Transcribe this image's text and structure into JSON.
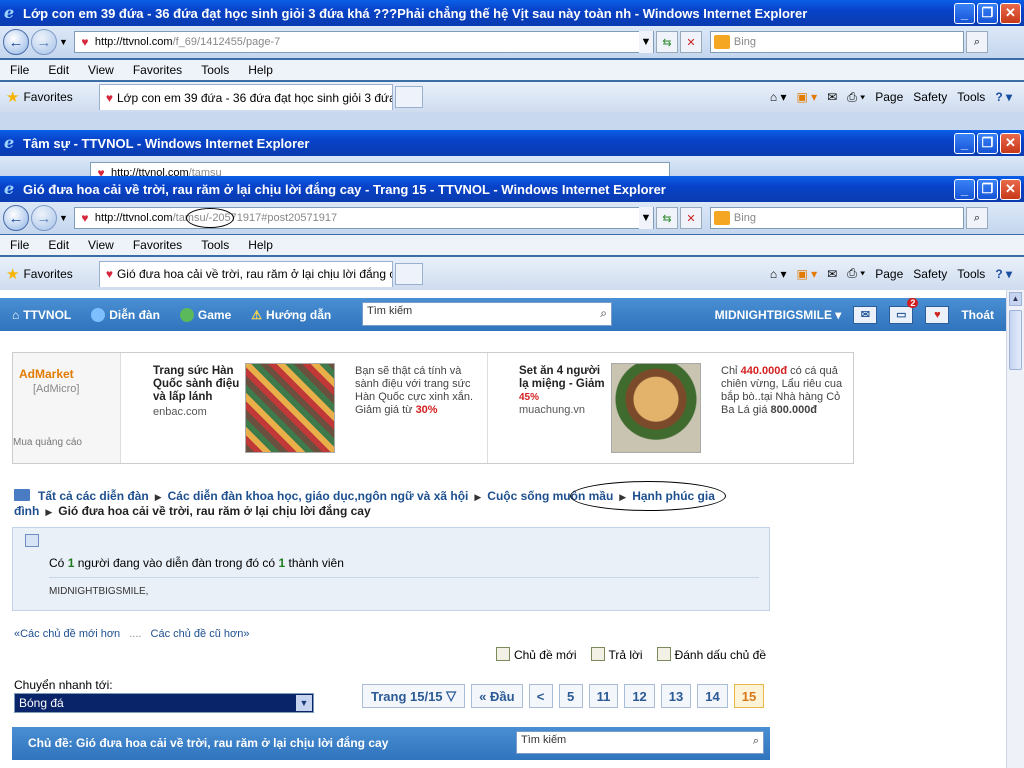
{
  "windows": [
    {
      "title": "Lớp con em 39 đứa - 36 đứa đạt học sinh giỏi 3 đứa khá ???Phải chẳng thế hệ Vịt sau này toàn nh - Windows Internet Explorer",
      "url_host": "http://ttvnol.com",
      "url_path": "/f_69/1412455/page-7",
      "search_placeholder": "Bing",
      "tab_title": "Lớp con em 39 đứa - 36 đứa đạt học sinh giỏi 3 đứa k..."
    },
    {
      "title": "Tâm sự - TTVNOL - Windows Internet Explorer",
      "url_host": "http://ttvnol.com",
      "url_path": "/tamsu"
    },
    {
      "title": "Gió đưa hoa cải về trời, rau răm ở lại chịu lời đắng cay - Trang 15 - TTVNOL - Windows Internet Explorer",
      "url_host": "http://ttvnol.com",
      "url_path": "/tamsu/",
      "url_rest": "-20571917#post20571917",
      "search_placeholder": "Bing",
      "tab_title": "Gió đưa hoa cải về trời, rau răm ở lại chịu lời đắng cay ..."
    }
  ],
  "menu": [
    "File",
    "Edit",
    "View",
    "Favorites",
    "Tools",
    "Help"
  ],
  "favorites_label": "Favorites",
  "command_bar": [
    "Page",
    "Safety",
    "Tools"
  ],
  "site_nav": {
    "items": [
      "TTVNOL",
      "Diễn đàn",
      "Game",
      "Hướng dẫn"
    ],
    "search_placeholder": "Tìm kiếm",
    "username": "MIDNIGHTBIGSMILE",
    "notification_count": "2",
    "logout": "Thoát"
  },
  "ad": {
    "brand": "AdMarket",
    "brand_sub": "[AdMicro]",
    "buy_label": "Mua quảng cáo",
    "item1_title": "Trang sức Hàn Quốc sành điệu và lấp lánh",
    "item1_source": "enbac.com",
    "item1_desc": "Bạn sẽ thật cá tính và sành điệu với trang sức Hàn Quốc cực xinh xắn. Giảm giá từ",
    "item1_discount": "30%",
    "item2_title": "Set ăn 4 người lạ miệng - Giảm",
    "item2_discount": "45%",
    "item2_source": "muachung.vn",
    "item2_desc_pre": "Chỉ",
    "item2_price": "440.000đ",
    "item2_desc": "có cá quả chiên vừng, Lẩu riêu cua bắp bò..tại Nhà hàng Cỏ Ba Lá giá",
    "item2_old_price": "800.000đ"
  },
  "breadcrumb": {
    "items": [
      "Tất cả các diễn đàn",
      "Các diễn đàn khoa học, giáo dục,ngôn ngữ và xã hội",
      "Cuộc sống muôn mầu",
      "Hạnh phúc gia đình"
    ],
    "current": "Gió đưa hoa cải về trời, rau răm ở lại chịu lời đắng cay"
  },
  "online": {
    "pre": "Có",
    "count1": "1",
    "mid": "người đang vào diễn đàn trong đó có",
    "count2": "1",
    "post": "thành viên",
    "members": "MIDNIGHTBIGSMILE,"
  },
  "thread_nav": {
    "newer": "«Các chủ đề mới hơn",
    "dots": "....",
    "older": "Các chủ đề cũ hơn»"
  },
  "actions": [
    "Chủ đề mới",
    "Trả lời",
    "Đánh dấu chủ đề"
  ],
  "jump": {
    "label": "Chuyển nhanh tới:",
    "selected": "Bóng đá"
  },
  "pager": {
    "label": "Trang 15/15",
    "first": "« Đầu",
    "prev": "<",
    "pages": [
      "5",
      "11",
      "12",
      "13",
      "14"
    ],
    "current": "15"
  },
  "thread_bar": {
    "title": "Chủ đề: Gió đưa hoa cải về trời, rau răm ở lại chịu lời đắng cay",
    "search_placeholder": "Tìm kiếm"
  }
}
